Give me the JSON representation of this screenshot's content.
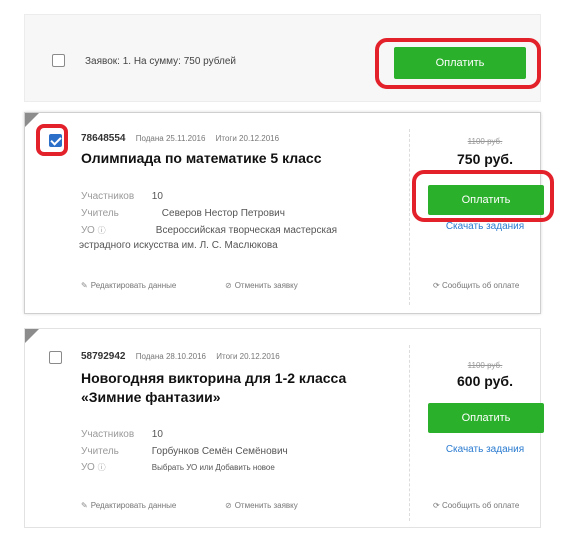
{
  "summary": {
    "text": "Заявок: 1. На сумму: 750 рублей",
    "pay_label": "Оплатить"
  },
  "orders": [
    {
      "number": "78648554",
      "submitted": "Подана 25.11.2016",
      "results": "Итоги 20.12.2016",
      "title": "Олимпиада по математике 5 класс",
      "participants_label": "Участников",
      "participants": "10",
      "teacher_label": "Учитель",
      "teacher": "Северов Нестор Петрович",
      "org_label": "УО",
      "org_line1": "Всероссийская творческая мастерская",
      "org_line2": "эстрадного искусства им. Л. С. Маслюкова",
      "edit_label": "Редактировать данные",
      "cancel_label": "Отменить заявку",
      "old_price": "1100 руб.",
      "price": "750 руб.",
      "pay_label": "Оплатить",
      "download_label": "Скачать задания",
      "notify_label": "Сообщить об оплате",
      "checked": true
    },
    {
      "number": "58792942",
      "submitted": "Подана 28.10.2016",
      "results": "Итоги 20.12.2016",
      "title_line1": "Новогодняя викторина для 1-2 класса",
      "title_line2": "«Зимние фантазии»",
      "participants_label": "Участников",
      "participants": "10",
      "teacher_label": "Учитель",
      "teacher": "Горбунков Семён Семёнович",
      "org_label": "УО",
      "org_choose": "Выбрать УО или Добавить новое",
      "edit_label": "Редактировать данные",
      "cancel_label": "Отменить заявку",
      "old_price": "1100 руб.",
      "price": "600 руб.",
      "pay_label": "Оплатить",
      "download_label": "Скачать задания",
      "notify_label": "Сообщить об оплате",
      "checked": false
    }
  ],
  "icons": {
    "edit": "pencil-icon",
    "cancel": "cancel-circle-icon",
    "notify": "refresh-icon",
    "info": "info-icon"
  },
  "colors": {
    "accent_green": "#2bb02b",
    "highlight_red": "#e3212b",
    "link_blue": "#2a7bd0",
    "checkbox_blue": "#2b6fc9"
  }
}
